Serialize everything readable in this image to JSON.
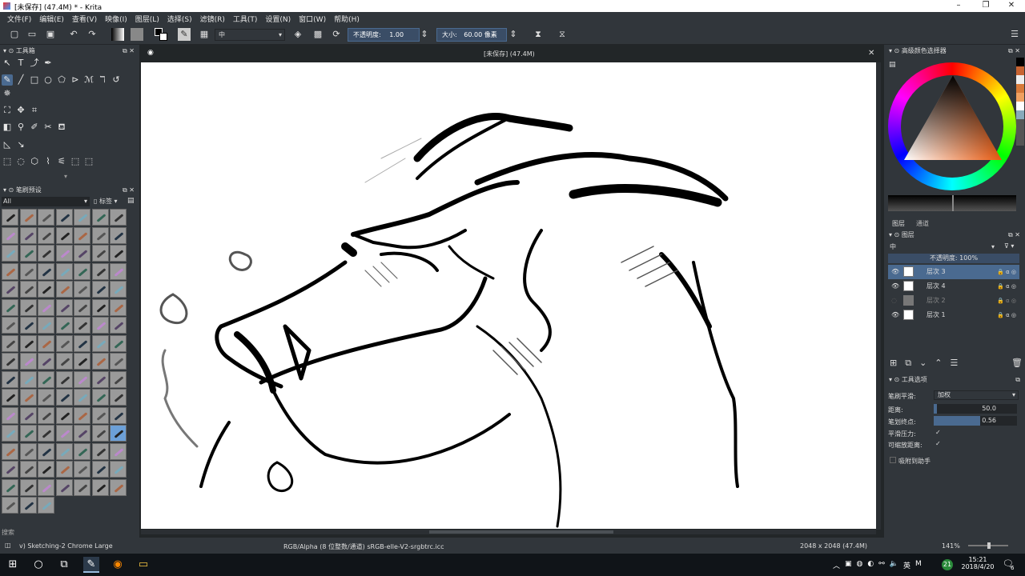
{
  "window": {
    "title": "[未保存] (47.4M) * - Krita"
  },
  "menu": [
    "文件(F)",
    "编辑(E)",
    "查看(V)",
    "映像(I)",
    "图层(L)",
    "选择(S)",
    "滤镜(R)",
    "工具(T)",
    "设置(N)",
    "窗口(W)",
    "帮助(H)"
  ],
  "toolbar": {
    "blend_mode": "中",
    "opacity_label": "不透明度:",
    "opacity_value": "1.00",
    "size_label": "大小:",
    "size_value": "60.00 像素"
  },
  "left_dock": {
    "toolbox_title": "工具箱",
    "presets_title": "笔刷预设",
    "presets_filter": "All",
    "presets_tag": "标签",
    "search_label": "搜索"
  },
  "canvas": {
    "document_title": "[未保存] (47.4M)"
  },
  "right_dock": {
    "color_selector_title": "高级颜色选择器",
    "tabs": [
      "图层",
      "通道"
    ],
    "layers_title": "图层",
    "blend_mode": "中",
    "opacity_label": "不透明度: 100%",
    "layers": [
      {
        "name": "层次 3",
        "visible": true,
        "selected": true
      },
      {
        "name": "层次 4",
        "visible": true,
        "selected": false
      },
      {
        "name": "层次 2",
        "visible": false,
        "selected": false
      },
      {
        "name": "层次 1",
        "visible": true,
        "selected": false
      }
    ],
    "tool_options_title": "工具选项",
    "smoothing_label": "笔刷平滑:",
    "smoothing_value": "加权",
    "distance_label": "距离:",
    "distance_value": "50.0",
    "stroke_end_label": "笔划终点:",
    "stroke_end_value": "0.56",
    "smooth_pressure_label": "平滑压力:",
    "scalable_distance_label": "可缩放距离:",
    "snap_label": "吸附到助手"
  },
  "status": {
    "brush": "v) Sketching-2 Chrome Large",
    "color_space": "RGB/Alpha (8 位整数/通道)  sRGB-elle-V2-srgbtrc.icc",
    "dimensions": "2048 x 2048 (47.4M)",
    "zoom": "141%"
  },
  "taskbar": {
    "time": "15:21",
    "date": "2018/4/20",
    "lang": "英",
    "badge": "21",
    "notif": "6"
  }
}
